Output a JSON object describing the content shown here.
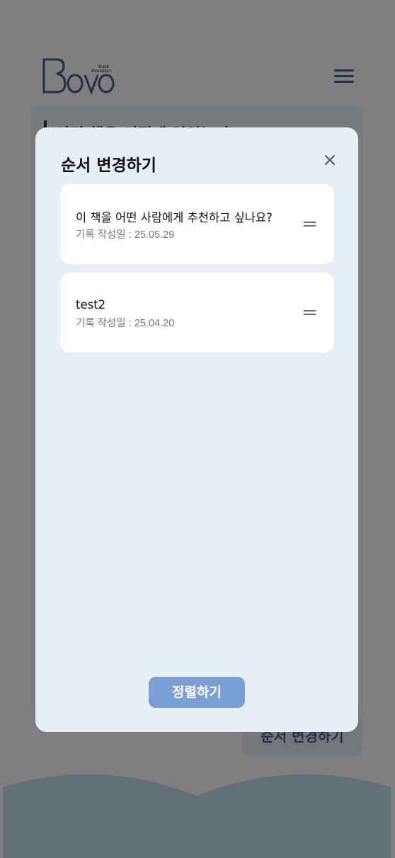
{
  "header": {
    "logo_text": "Bovo",
    "logo_subtext": [
      "Book",
      "Evolution"
    ]
  },
  "background": {
    "card_title": "어떤 책을 어떻게 읽었는지",
    "reorder_button_label": "순서 변경하기"
  },
  "modal": {
    "title": "순서 변경하기",
    "items": [
      {
        "title": "이 책을 어떤 사람에게 추천하고 싶나요?",
        "date": "기록 작성일 : 25.05.29"
      },
      {
        "title": "test2",
        "date": "기록 작성일 : 25.04.20"
      }
    ],
    "sort_button_label": "정렬하기"
  },
  "colors": {
    "brand": "#3e5b86",
    "modal_bg": "#e6eff5",
    "sort_button": "#7aa0d6"
  },
  "icons": [
    "menu-icon",
    "close-icon",
    "drag-handle-icon"
  ]
}
